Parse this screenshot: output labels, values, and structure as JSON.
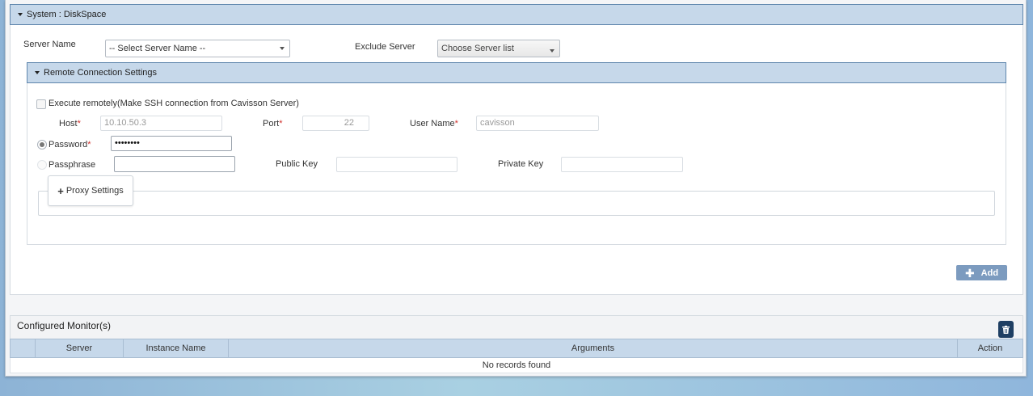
{
  "panel": {
    "title": "System : DiskSpace"
  },
  "server_name": {
    "label": "Server Name",
    "value": "-- Select Server Name --"
  },
  "exclude_server": {
    "label": "Exclude Server",
    "value": "Choose Server list"
  },
  "remote": {
    "title": "Remote Connection Settings",
    "execute_label": "Execute remotely(Make SSH connection from Cavisson Server)",
    "host_label": "Host",
    "host_value": "10.10.50.3",
    "port_label": "Port",
    "port_value": "22",
    "username_label": "User Name",
    "username_value": "cavisson",
    "required_mark": "*",
    "password_label": "Password",
    "password_value": "••••••••",
    "passphrase_label": "Passphrase",
    "public_key_label": "Public Key",
    "private_key_label": "Private Key",
    "proxy_label": "Proxy Settings",
    "proxy_plus": "+"
  },
  "add_button": {
    "label": "Add",
    "icon": "plus-icon"
  },
  "configured": {
    "title": "Configured Monitor(s)",
    "columns": [
      "",
      "Server",
      "Instance Name",
      "Arguments",
      "Action"
    ],
    "empty_message": "No records found",
    "delete_icon": "trash-icon"
  }
}
